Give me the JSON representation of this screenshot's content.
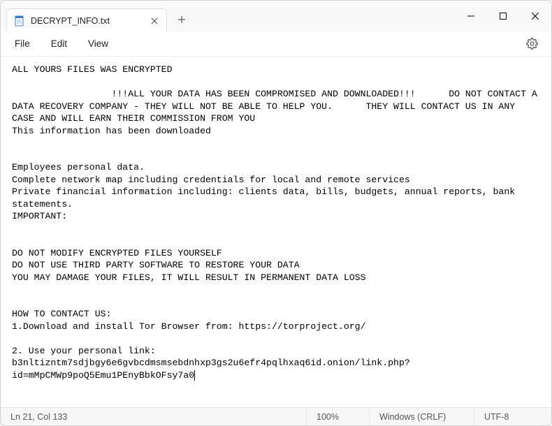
{
  "window": {
    "tab_title": "DECRYPT_INFO.txt",
    "icons": {
      "app": "notepad-icon",
      "tab_close": "close-icon",
      "new_tab": "plus-icon",
      "minimize": "minimize-icon",
      "maximize": "maximize-icon",
      "window_close": "close-icon",
      "settings": "gear-icon"
    }
  },
  "menubar": {
    "file": "File",
    "edit": "Edit",
    "view": "View"
  },
  "document": {
    "text": "ALL YOURS FILES WAS ENCRYPTED\n\n                  !!!ALL YOUR DATA HAS BEEN COMPROMISED AND DOWNLOADED!!!      DO NOT CONTACT A DATA RECOVERY COMPANY - THEY WILL NOT BE ABLE TO HELP YOU.      THEY WILL CONTACT US IN ANY CASE AND WILL EARN THEIR COMMISSION FROM YOU\nThis information has been downloaded\n\n\nEmployees personal data.\nComplete network map including credentials for local and remote services\nPrivate financial information including: clients data, bills, budgets, annual reports, bank statements.\nIMPORTANT:\n\n\nDO NOT MODIFY ENCRYPTED FILES YOURSELF\nDO NOT USE THIRD PARTY SOFTWARE TO RESTORE YOUR DATA\nYOU MAY DAMAGE YOUR FILES, IT WILL RESULT IN PERMANENT DATA LOSS\n\n\nHOW TO CONTACT US:\n1.Download and install Tor Browser from: https://torproject.org/\n\n2. Use your personal link: b3nltizntm7sdjbgy6e6gvbcdmsmsebdnhxp3gs2u6efr4pqlhxaq6id.onion/link.php?id=mMpCMWp9poQ5Emu1PEnyBbkOFsy7a0"
  },
  "statusbar": {
    "position": "Ln 21, Col 133",
    "zoom": "100%",
    "line_ending": "Windows (CRLF)",
    "encoding": "UTF-8"
  }
}
